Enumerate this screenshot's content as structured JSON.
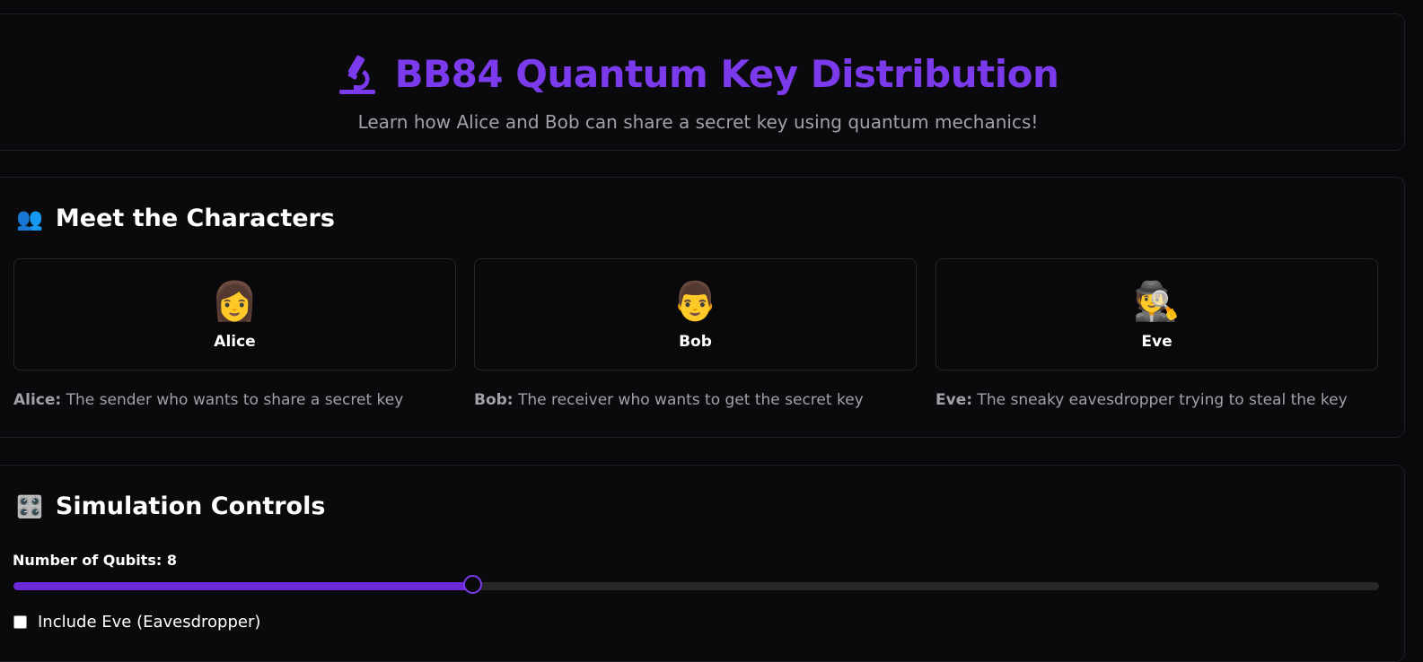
{
  "header": {
    "icon": "microscope-icon",
    "title": "BB84 Quantum Key Distribution",
    "subtitle": "Learn how Alice and Bob can share a secret key using quantum mechanics!"
  },
  "characters_section": {
    "icon": "👥",
    "title": "Meet the Characters",
    "cards": [
      {
        "emoji": "👩",
        "name": "Alice"
      },
      {
        "emoji": "👨",
        "name": "Bob"
      },
      {
        "emoji": "🕵️",
        "name": "Eve"
      }
    ],
    "descriptions": [
      {
        "name": "Alice:",
        "text": " The sender who wants to share a secret key"
      },
      {
        "name": "Bob:",
        "text": " The receiver who wants to get the secret key"
      },
      {
        "name": "Eve:",
        "text": " The sneaky eavesdropper trying to steal the key"
      }
    ]
  },
  "controls_section": {
    "icon": "🎛️",
    "title": "Simulation Controls",
    "qubits_label": "Number of Qubits: 8",
    "qubits_fraction": 0.336,
    "eve_label": "Include Eve (Eavesdropper)",
    "eve_checked": false
  },
  "colors": {
    "accent": "#7c3aed",
    "background": "#09090b",
    "muted_text": "#a1a1aa"
  }
}
